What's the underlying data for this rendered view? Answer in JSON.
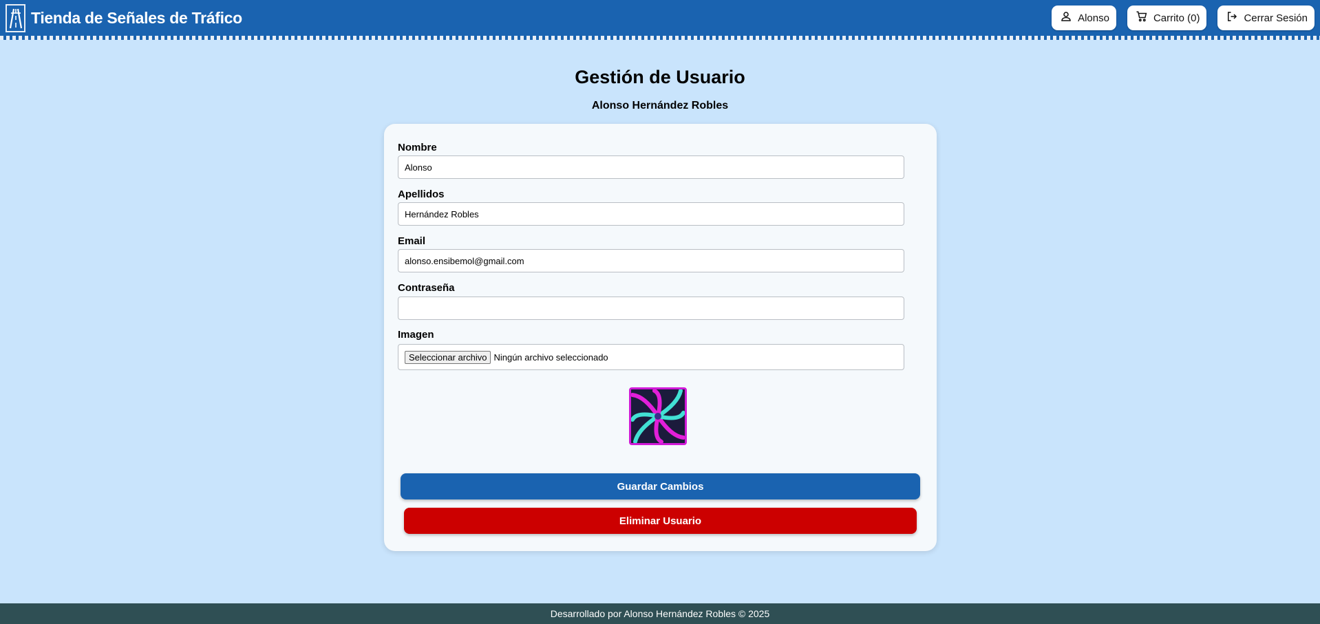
{
  "header": {
    "title": "Tienda de Señales de Tráfico",
    "user_label": "Alonso",
    "cart_label": "Carrito (0)",
    "logout_label": "Cerrar Sesión"
  },
  "page": {
    "title": "Gestión de Usuario",
    "subtitle": "Alonso Hernández Robles"
  },
  "form": {
    "nombre_label": "Nombre",
    "nombre_value": "Alonso",
    "apellidos_label": "Apellidos",
    "apellidos_value": "Hernández Robles",
    "email_label": "Email",
    "email_value": "alonso.ensibemol@gmail.com",
    "password_label": "Contraseña",
    "password_value": "",
    "imagen_label": "Imagen",
    "file_button_label": "Seleccionar archivo",
    "file_status": "Ningún archivo seleccionado",
    "save_label": "Guardar Cambios",
    "delete_label": "Eliminar Usuario"
  },
  "footer": {
    "text": "Desarrollado por Alonso Hernández Robles © 2025"
  },
  "colors": {
    "header": "#1a63b0",
    "background": "#c9e4fc",
    "save": "#1a63b0",
    "delete": "#cc0000",
    "footer": "#2f4f54"
  },
  "icons": {
    "logo": "highway-sign-icon",
    "user": "user-icon",
    "cart": "cart-icon",
    "logout": "logout-icon"
  }
}
